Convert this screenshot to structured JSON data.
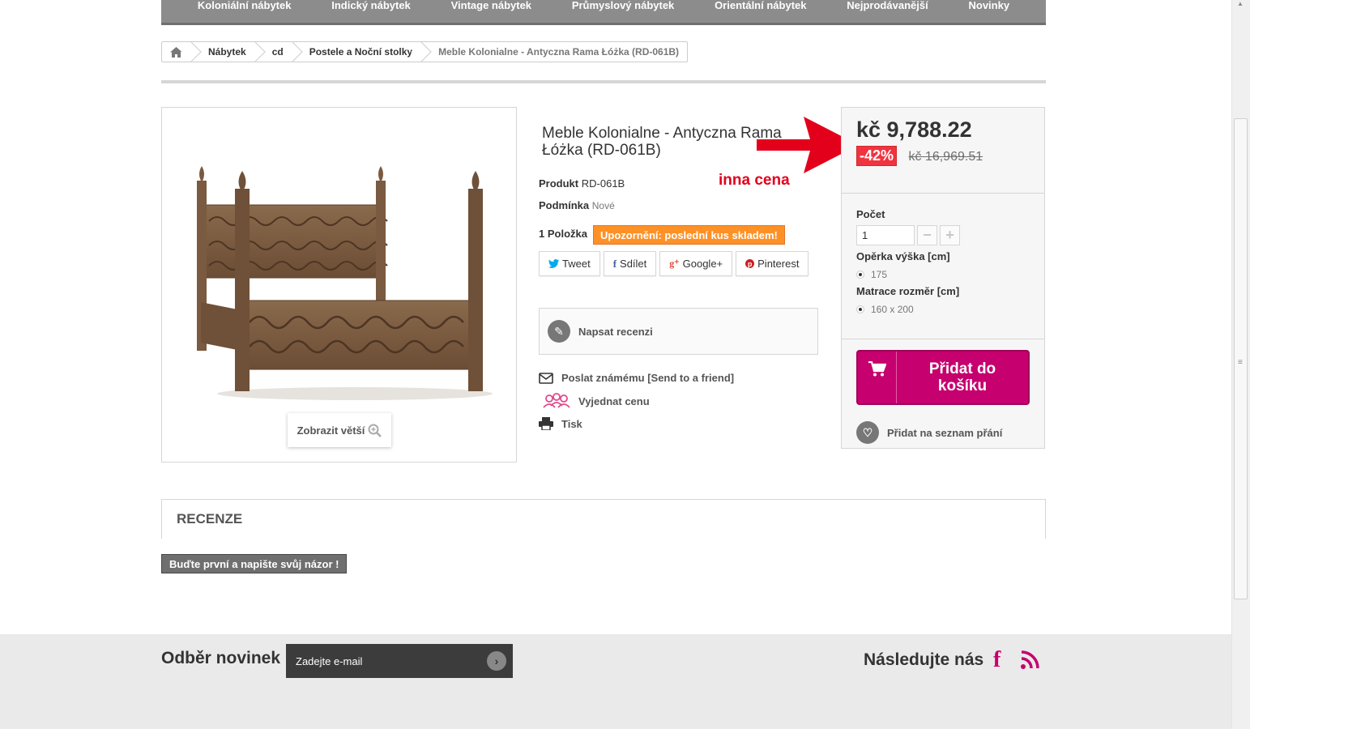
{
  "nav": {
    "items": [
      "Koloniální nábytek",
      "Indický nábytek",
      "Vintage nábytek",
      "Průmyslový nábytek",
      "Orientální nábytek",
      "Nejprodávanější",
      "Novinky"
    ]
  },
  "breadcrumb": {
    "items": [
      "Nábytek",
      "cd",
      "Postele a Noční stolky",
      "Meble Kolonialne - Antyczna Rama Łóżka (RD-061B)"
    ]
  },
  "image": {
    "zoom_label": "Zobrazit větší"
  },
  "product": {
    "title": "Meble Kolonialne - Antyczna Rama Łóżka (RD-061B)",
    "ref_label": "Produkt",
    "ref_value": "RD-061B",
    "condition_label": "Podmínka",
    "condition_value": "Nové",
    "qty_text": "1 Položka",
    "warning": "Upozornění: poslední kus skladem!",
    "annotation": "inna cena"
  },
  "social": [
    "Tweet",
    "Sdílet",
    "Google+",
    "Pinterest"
  ],
  "review_box": {
    "label": "Napsat recenzi"
  },
  "extras": {
    "send_friend": "Poslat známému [Send to a friend]",
    "negotiate": "Vyjednat cenu",
    "print": "Tisk"
  },
  "buy": {
    "price": "kč 9,788.22",
    "reduction": "-42%",
    "old_price": "kč 16,969.51",
    "qty_label": "Počet",
    "qty_value": "1",
    "opt1_label": "Opěrka výška [cm]",
    "opt1_value": "175",
    "opt2_label": "Matrace rozměr [cm]",
    "opt2_value": "160 x 200",
    "cart_label": "Přidat do košíku",
    "wishlist_label": "Přidat na seznam přání"
  },
  "reviews": {
    "title": "RECENZE",
    "first_button": "Buďte první a napište svůj názor !"
  },
  "footer": {
    "newsletter_title": "Odběr novinek",
    "newsletter_placeholder": "Zadejte e-mail",
    "follow_title": "Následujte nás",
    "fb_glyph": "f"
  },
  "colors": {
    "accent": "#c6006e",
    "warning": "#fe9126",
    "reduction": "#f13340",
    "annotation": "#e3001b",
    "nav": "#8c8c8c"
  }
}
